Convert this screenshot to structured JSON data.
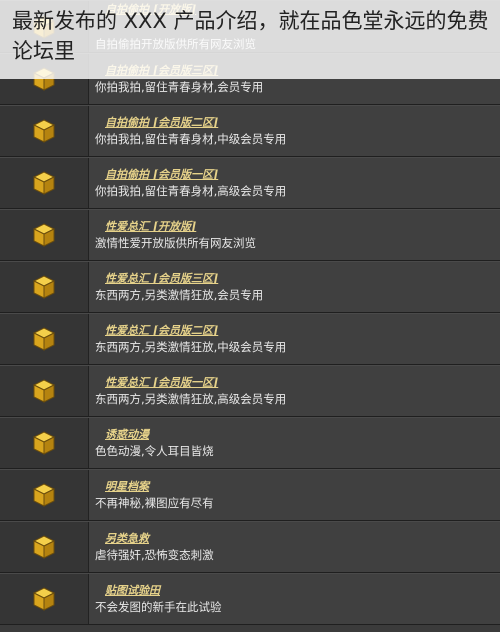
{
  "overlay": {
    "caption": "最新发布的 XXX 产品介绍，就在品色堂永远的免费论坛里"
  },
  "colors": {
    "background": "#3b3b3b",
    "row_bg": "#404040",
    "icon_cell_bg": "#353535",
    "title_gold": "#e6d28a",
    "text": "#e8e8e8",
    "icon_gold": "#d9a51e"
  },
  "forums": [
    {
      "title": "自拍偷拍 [开放版]",
      "desc": "自拍偷拍开放版供所有网友浏览",
      "icon": "box-icon"
    },
    {
      "title": "自拍偷拍 [会员版三区]",
      "desc": "你拍我拍,留住青春身材,会员专用",
      "icon": "box-icon"
    },
    {
      "title": "自拍偷拍 [会员版二区]",
      "desc": "你拍我拍,留住青春身材,中级会员专用",
      "icon": "box-icon"
    },
    {
      "title": "自拍偷拍 [会员版一区]",
      "desc": "你拍我拍,留住青春身材,高级会员专用",
      "icon": "box-icon"
    },
    {
      "title": "性爱总汇 [开放版]",
      "desc": "激情性爱开放版供所有网友浏览",
      "icon": "box-icon"
    },
    {
      "title": "性爱总汇 [会员版三区]",
      "desc": "东西两方,另类激情狂放,会员专用",
      "icon": "box-icon"
    },
    {
      "title": "性爱总汇 [会员版二区]",
      "desc": "东西两方,另类激情狂放,中级会员专用",
      "icon": "box-icon"
    },
    {
      "title": "性爱总汇 [会员版一区]",
      "desc": "东西两方,另类激情狂放,高级会员专用",
      "icon": "box-icon"
    },
    {
      "title": "诱惑动漫",
      "desc": "色色动漫,令人耳目皆烧",
      "icon": "box-icon"
    },
    {
      "title": "明星档案",
      "desc": "不再神秘,裸图应有尽有",
      "icon": "box-icon"
    },
    {
      "title": "另类急救",
      "desc": "虐待强奸,恐怖变态刺激",
      "icon": "box-icon"
    },
    {
      "title": "贴图试验田",
      "desc": "不会发图的新手在此试验",
      "icon": "box-icon"
    }
  ]
}
